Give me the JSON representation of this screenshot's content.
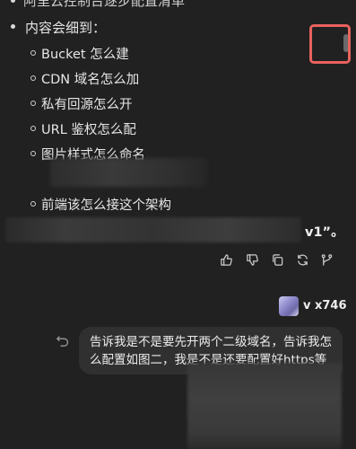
{
  "assistant": {
    "top_cutoff": "阿里云控制台逐步配置清单",
    "main_item": "内容会细到：",
    "sub_items": [
      "Bucket 怎么建",
      "CDN 域名怎么加",
      "私有回源怎么开",
      "URL 鉴权怎么配",
      "图片样式怎么命名",
      "前端该怎么接这个架构"
    ],
    "suffix_text": "v1”。"
  },
  "actions": [
    {
      "name": "thumbs-up-icon"
    },
    {
      "name": "thumbs-down-icon"
    },
    {
      "name": "copy-icon"
    },
    {
      "name": "regenerate-icon"
    },
    {
      "name": "branch-icon"
    }
  ],
  "user": {
    "name": "v x746",
    "message": "告诉我是不是要先开两个二级域名，告诉我怎么配置如图二，我是不是还要配置好https等"
  },
  "colors": {
    "background": "#212121",
    "bubble": "#303030",
    "highlight": "#e8625e"
  }
}
